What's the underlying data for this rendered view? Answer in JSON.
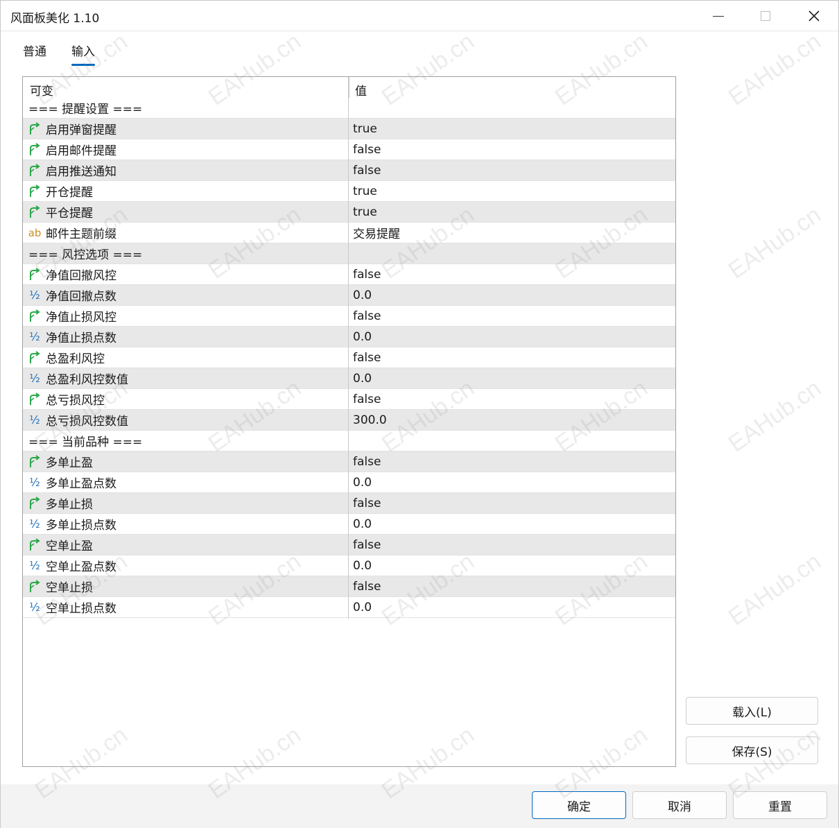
{
  "window": {
    "title": "风面板美化 1.10"
  },
  "tabs": [
    {
      "label": "普通",
      "active": false
    },
    {
      "label": "输入",
      "active": true
    }
  ],
  "grid": {
    "headers": {
      "name": "可变",
      "value": "值"
    },
    "rows": [
      {
        "type": "section",
        "name": "=== 提醒设置 ===",
        "value": ""
      },
      {
        "type": "bool",
        "name": "启用弹窗提醒",
        "value": "true"
      },
      {
        "type": "bool",
        "name": "启用邮件提醒",
        "value": "false"
      },
      {
        "type": "bool",
        "name": "启用推送通知",
        "value": "false"
      },
      {
        "type": "bool",
        "name": "开仓提醒",
        "value": "true"
      },
      {
        "type": "bool",
        "name": "平仓提醒",
        "value": "true"
      },
      {
        "type": "string",
        "name": "邮件主题前缀",
        "value": "交易提醒"
      },
      {
        "type": "section",
        "name": "=== 风控选项 ===",
        "value": ""
      },
      {
        "type": "bool",
        "name": "净值回撤风控",
        "value": "false"
      },
      {
        "type": "double",
        "name": "净值回撤点数",
        "value": "0.0"
      },
      {
        "type": "bool",
        "name": "净值止损风控",
        "value": "false"
      },
      {
        "type": "double",
        "name": "净值止损点数",
        "value": "0.0"
      },
      {
        "type": "bool",
        "name": "总盈利风控",
        "value": "false"
      },
      {
        "type": "double",
        "name": "总盈利风控数值",
        "value": "0.0"
      },
      {
        "type": "bool",
        "name": "总亏损风控",
        "value": "false"
      },
      {
        "type": "double",
        "name": "总亏损风控数值",
        "value": "300.0"
      },
      {
        "type": "section",
        "name": "=== 当前品种 ===",
        "value": ""
      },
      {
        "type": "bool",
        "name": "多单止盈",
        "value": "false"
      },
      {
        "type": "double",
        "name": "多单止盈点数",
        "value": "0.0"
      },
      {
        "type": "bool",
        "name": "多单止损",
        "value": "false"
      },
      {
        "type": "double",
        "name": "多单止损点数",
        "value": "0.0"
      },
      {
        "type": "bool",
        "name": "空单止盈",
        "value": "false"
      },
      {
        "type": "double",
        "name": "空单止盈点数",
        "value": "0.0"
      },
      {
        "type": "bool",
        "name": "空单止损",
        "value": "false"
      },
      {
        "type": "double",
        "name": "空单止损点数",
        "value": "0.0"
      }
    ]
  },
  "side_buttons": {
    "load": "载入(L)",
    "save": "保存(S)"
  },
  "footer_buttons": {
    "ok": "确定",
    "cancel": "取消",
    "reset": "重置"
  },
  "icons": {
    "bool": "green-arrow-icon",
    "double": "half-icon",
    "string": "ab-icon"
  },
  "colors": {
    "accent": "#0067c0",
    "bool_icon": "#2aa84a",
    "double_icon": "#1f6fb5",
    "string_icon": "#c89020",
    "row_shade": "#e8e8e8"
  },
  "watermark": "EAHub.cn"
}
